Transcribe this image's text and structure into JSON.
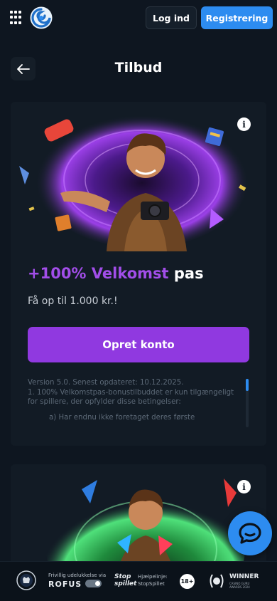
{
  "header": {
    "login_label": "Log ind",
    "register_label": "Registrering"
  },
  "page": {
    "title": "Tilbud"
  },
  "offer": {
    "title_accent": "+100% Velkomst",
    "title_rest": " pas",
    "subtitle": "Få op til 1.000 kr.!",
    "cta_label": "Opret konto",
    "terms_line1": "Version 5.0. Senest opdateret: 10.12.2025.",
    "terms_line2": "1. 100% Velkomstpas-bonustilbuddet er kun tilgængeligt for spillere, der opfylder disse betingelser:",
    "terms_line3": "a) Har endnu ikke foretaget deres første"
  },
  "footer": {
    "rofus_small": "Frivillig udelukkelse via",
    "rofus_big": "ROFUS",
    "stop_logo_top": "Stop",
    "stop_logo_bottom": "spillet",
    "stop_help_line1": "Hjælpelinje:",
    "stop_help_line2": "StopSpillet",
    "age": "18+",
    "winner": "WINNER",
    "winner_sub1": "CASINO GURU",
    "winner_sub2": "AWARDS 2024"
  },
  "colors": {
    "accent_purple": "#9039e0",
    "primary_blue": "#2d8cf0",
    "background": "#0e1620"
  }
}
